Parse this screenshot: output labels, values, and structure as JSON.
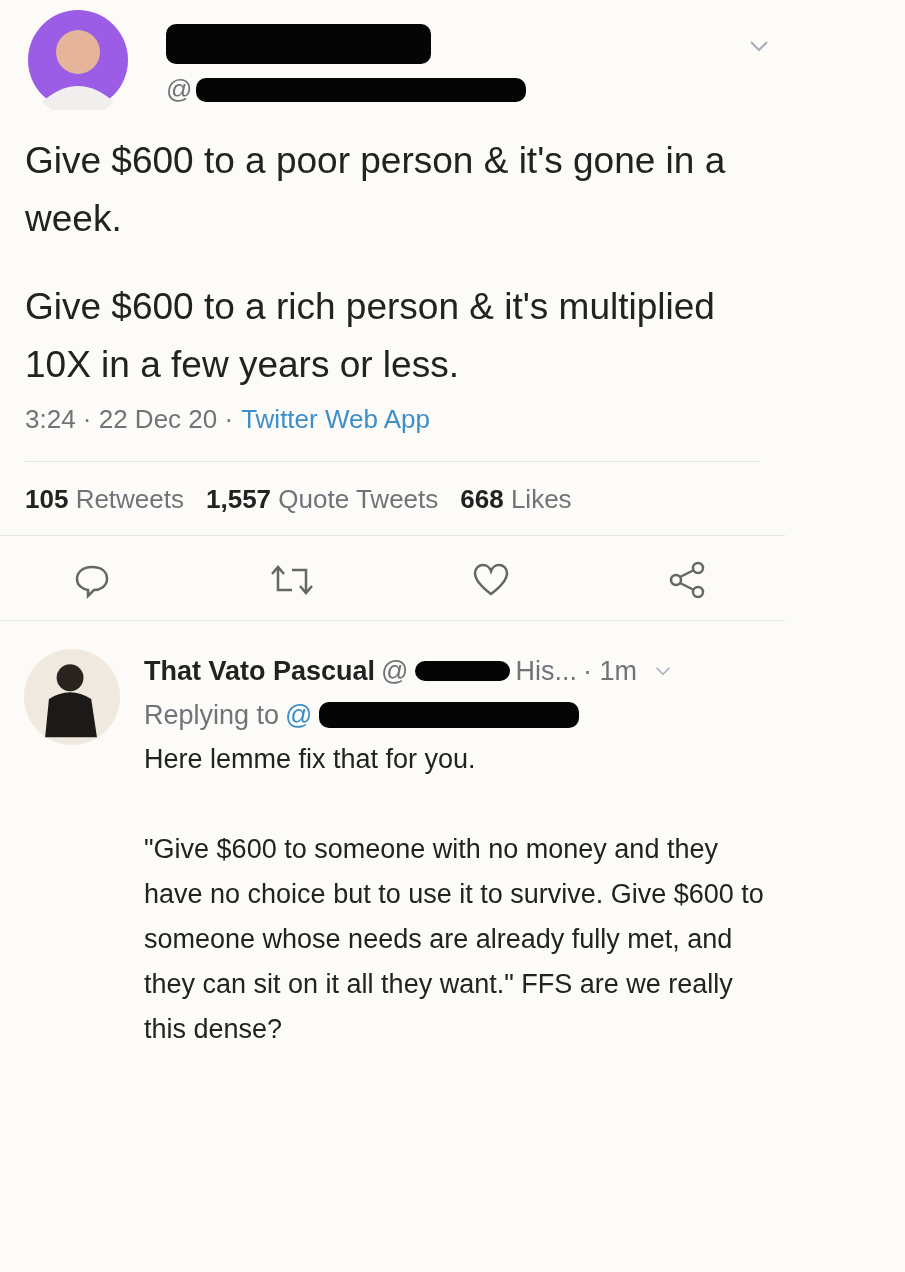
{
  "tweet": {
    "handle_visible": "@",
    "paragraphs": [
      "Give $600 to a poor person & it's gone in a week.",
      "Give $600 to a rich person & it's multiplied 10X in a few years or less."
    ],
    "time": "3:24 · 22 Dec 20 ·",
    "source": "Twitter Web App"
  },
  "stats": [
    {
      "count": "105",
      "label": "Retweets"
    },
    {
      "count": "1,557",
      "label": "Quote Tweets"
    },
    {
      "count": "668",
      "label": "Likes"
    }
  ],
  "actions": [
    {
      "kind": "reply"
    },
    {
      "kind": "retweet"
    },
    {
      "kind": "like"
    },
    {
      "kind": "share"
    }
  ],
  "reply": {
    "name": "That Vato Pascual",
    "handle_start": "@",
    "handle_end": "His...",
    "time": "· 1m",
    "replying_label": "Replying to",
    "replying_handle": "@",
    "paragraphs": [
      "Here lemme fix that for you.",
      "\"Give $600 to someone with no money and they have no choice but to use it to survive. Give $600 to someone whose needs are already fully met, and they can sit on it all they want.\" FFS are we really this dense?"
    ]
  }
}
